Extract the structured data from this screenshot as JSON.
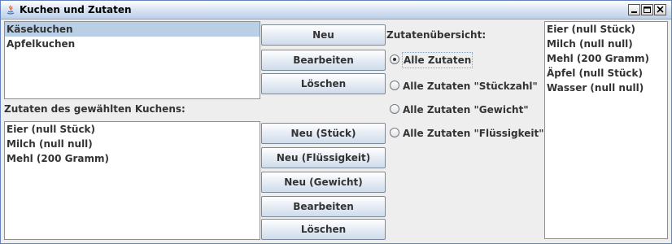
{
  "window": {
    "title": "Kuchen und Zutaten"
  },
  "cakes": {
    "items": [
      {
        "label": "Käsekuchen",
        "selected": true
      },
      {
        "label": "Apfelkuchen",
        "selected": false
      }
    ],
    "buttons": {
      "new": "Neu",
      "edit": "Bearbeiten",
      "delete": "Löschen"
    }
  },
  "ingredients": {
    "heading": "Zutaten des gewählten Kuchens:",
    "items": [
      {
        "label": "Eier (null Stück)"
      },
      {
        "label": "Milch (null null)"
      },
      {
        "label": "Mehl (200 Gramm)"
      }
    ],
    "buttons": {
      "new_count": "Neu (Stück)",
      "new_liquid": "Neu (Flüssigkeit)",
      "new_weight": "Neu (Gewicht)",
      "edit": "Bearbeiten",
      "delete": "Löschen"
    }
  },
  "overview": {
    "heading": "Zutatenübersicht:",
    "filters": [
      {
        "label": "Alle Zutaten",
        "checked": true
      },
      {
        "label": "Alle Zutaten \"Stückzahl\"",
        "checked": false
      },
      {
        "label": "Alle Zutaten \"Gewicht\"",
        "checked": false
      },
      {
        "label": "Alle Zutaten \"Flüssigkeit\"",
        "checked": false
      }
    ],
    "items": [
      {
        "label": "Eier (null Stück)"
      },
      {
        "label": "Milch (null null)"
      },
      {
        "label": "Mehl (200 Gramm)"
      },
      {
        "label": "Äpfel (null Stück)"
      },
      {
        "label": "Wasser (null null)"
      }
    ]
  },
  "colors": {
    "selection": "#b8cfe5",
    "titlebar_end": "#bccfe9",
    "border": "#6382bf"
  }
}
